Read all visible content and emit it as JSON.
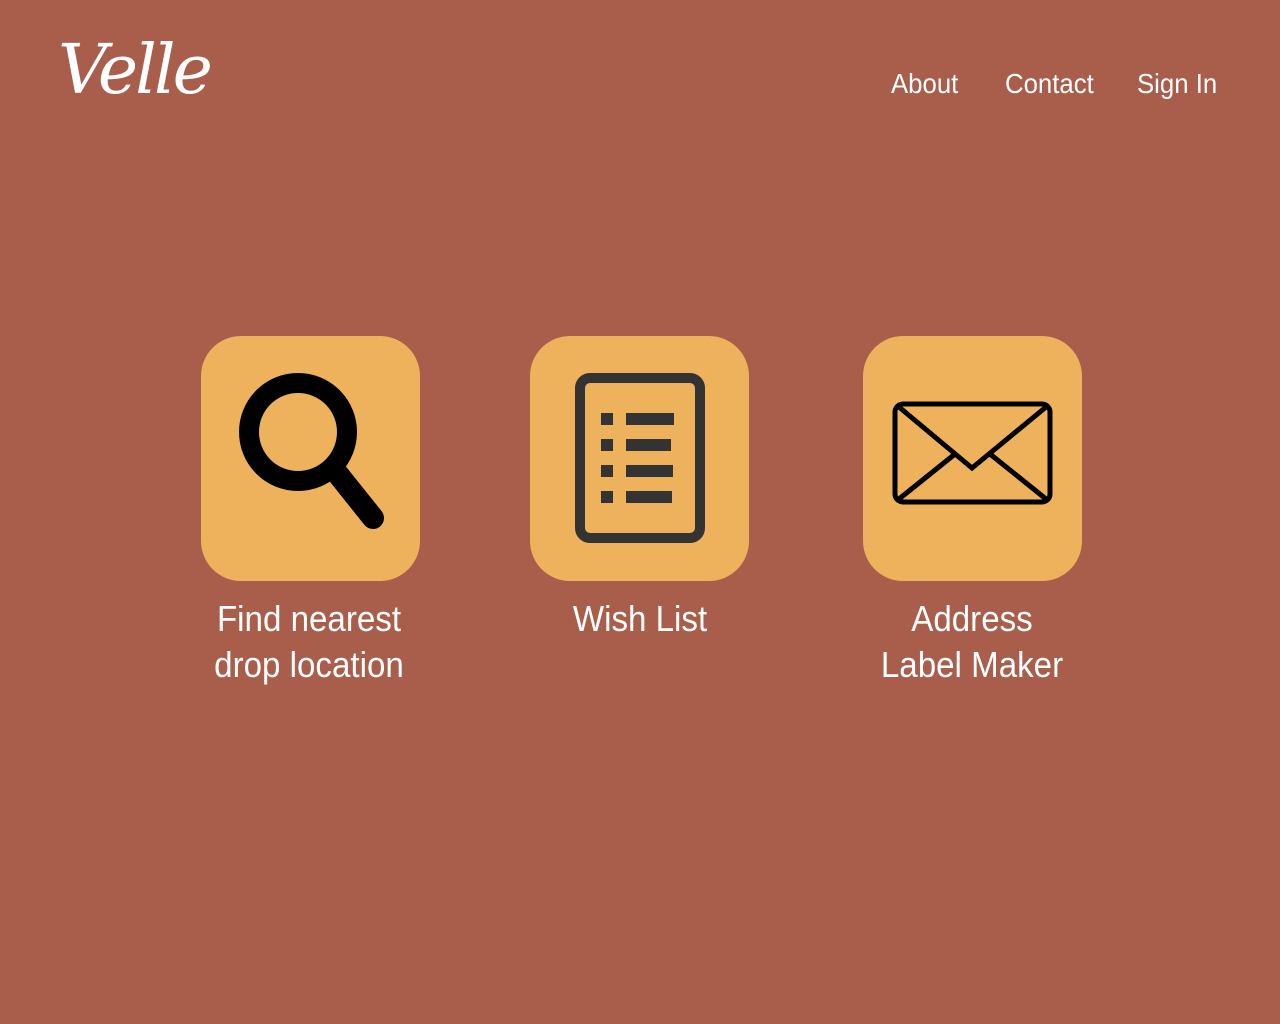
{
  "header": {
    "logo": "Velle",
    "nav": [
      "About",
      "Contact",
      "Sign In"
    ]
  },
  "tiles": [
    {
      "icon": "search-icon",
      "caption_lines": [
        "Find nearest",
        "drop location"
      ]
    },
    {
      "icon": "list-document-icon",
      "caption_lines": [
        "Wish List"
      ]
    },
    {
      "icon": "envelope-icon",
      "caption_lines": [
        "Address",
        "Label Maker"
      ]
    }
  ],
  "colors": {
    "background": "#a95d4b",
    "tile": "#efb25c",
    "text": "#ffffff",
    "icon_dark": "#000000",
    "icon_gray": "#333333"
  }
}
